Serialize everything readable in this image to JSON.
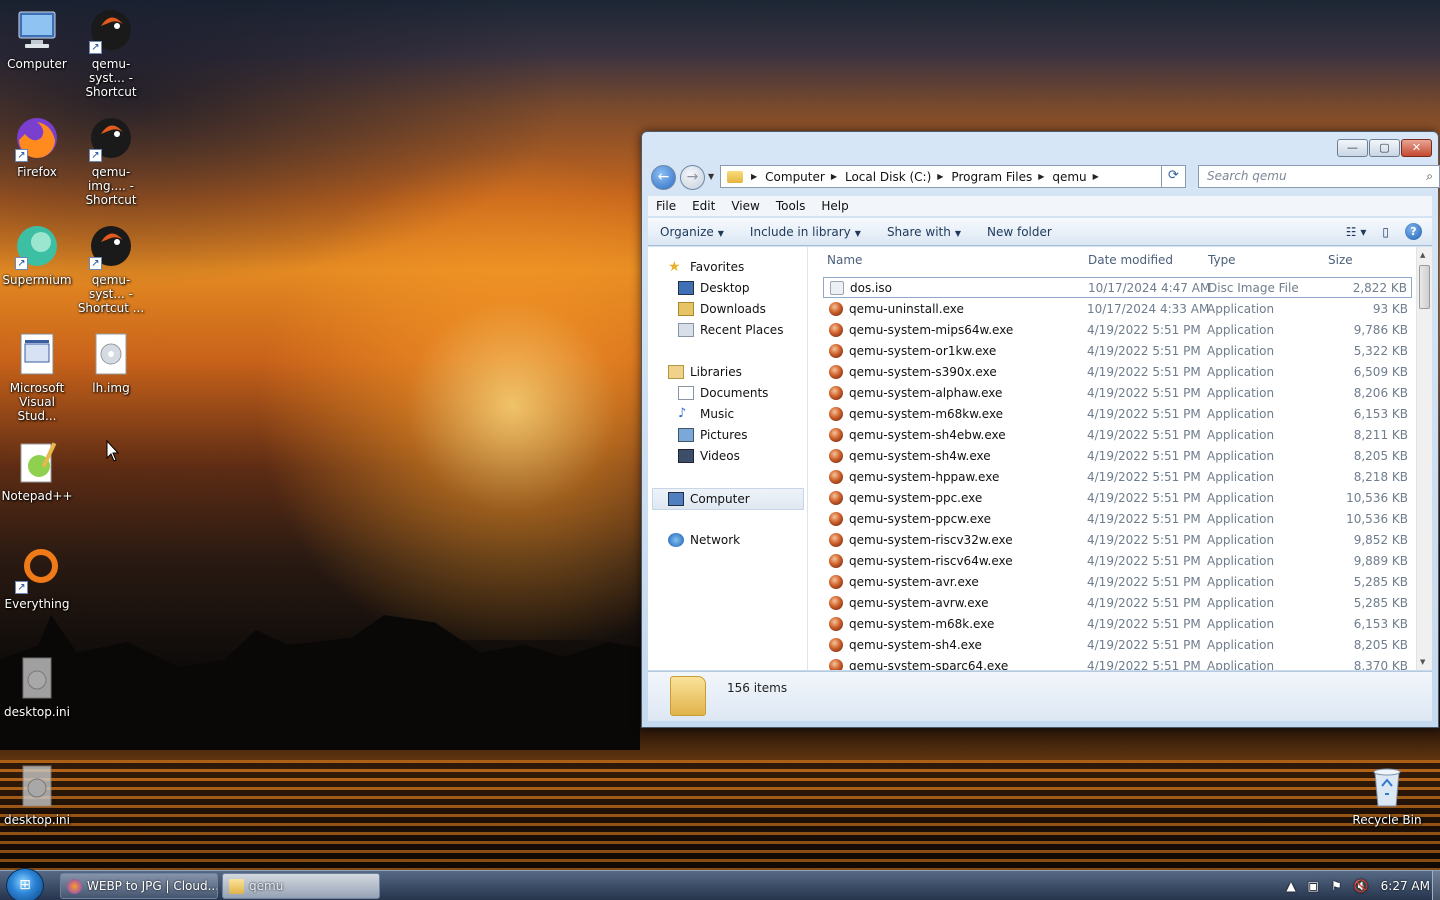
{
  "desktop": {
    "icons": [
      {
        "label": "Computer",
        "icon": "computer-icon"
      },
      {
        "label": "qemu-syst... - Shortcut",
        "icon": "qemu-icon"
      },
      {
        "label": "Firefox",
        "icon": "firefox-icon"
      },
      {
        "label": "qemu-img.... - Shortcut",
        "icon": "qemu-icon"
      },
      {
        "label": "Supermium",
        "icon": "supermium-icon"
      },
      {
        "label": "qemu-syst... - Shortcut ...",
        "icon": "qemu-icon"
      },
      {
        "label": "Microsoft Visual Stud...",
        "icon": "visual-studio-icon"
      },
      {
        "label": "lh.img",
        "icon": "disc-image-icon"
      },
      {
        "label": "Notepad++",
        "icon": "notepadpp-icon"
      },
      {
        "label": "Everything",
        "icon": "everything-icon"
      },
      {
        "label": "desktop.ini",
        "icon": "ini-file-icon"
      },
      {
        "label": "desktop.ini",
        "icon": "ini-file-icon"
      },
      {
        "label": "Recycle Bin",
        "icon": "recycle-bin-icon"
      }
    ]
  },
  "explorer": {
    "breadcrumb": [
      "Computer",
      "Local Disk (C:)",
      "Program Files",
      "qemu"
    ],
    "search_placeholder": "Search qemu",
    "menu": [
      "File",
      "Edit",
      "View",
      "Tools",
      "Help"
    ],
    "commands": [
      "Organize",
      "Include in library",
      "Share with",
      "New folder"
    ],
    "nav": {
      "favorites": {
        "label": "Favorites",
        "items": [
          "Desktop",
          "Downloads",
          "Recent Places"
        ]
      },
      "libraries": {
        "label": "Libraries",
        "items": [
          "Documents",
          "Music",
          "Pictures",
          "Videos"
        ]
      },
      "computer": "Computer",
      "network": "Network"
    },
    "columns": {
      "name": "Name",
      "date": "Date modified",
      "type": "Type",
      "size": "Size"
    },
    "files": [
      {
        "name": "dos.iso",
        "date": "10/17/2024 4:47 AM",
        "type": "Disc Image File",
        "size": "2,822 KB",
        "icon": "disc"
      },
      {
        "name": "qemu-uninstall.exe",
        "date": "10/17/2024 4:33 AM",
        "type": "Application",
        "size": "93 KB",
        "icon": "app"
      },
      {
        "name": "qemu-system-mips64w.exe",
        "date": "4/19/2022 5:51 PM",
        "type": "Application",
        "size": "9,786 KB",
        "icon": "app"
      },
      {
        "name": "qemu-system-or1kw.exe",
        "date": "4/19/2022 5:51 PM",
        "type": "Application",
        "size": "5,322 KB",
        "icon": "app"
      },
      {
        "name": "qemu-system-s390x.exe",
        "date": "4/19/2022 5:51 PM",
        "type": "Application",
        "size": "6,509 KB",
        "icon": "app"
      },
      {
        "name": "qemu-system-alphaw.exe",
        "date": "4/19/2022 5:51 PM",
        "type": "Application",
        "size": "8,206 KB",
        "icon": "app"
      },
      {
        "name": "qemu-system-m68kw.exe",
        "date": "4/19/2022 5:51 PM",
        "type": "Application",
        "size": "6,153 KB",
        "icon": "app"
      },
      {
        "name": "qemu-system-sh4ebw.exe",
        "date": "4/19/2022 5:51 PM",
        "type": "Application",
        "size": "8,211 KB",
        "icon": "app"
      },
      {
        "name": "qemu-system-sh4w.exe",
        "date": "4/19/2022 5:51 PM",
        "type": "Application",
        "size": "8,205 KB",
        "icon": "app"
      },
      {
        "name": "qemu-system-hppaw.exe",
        "date": "4/19/2022 5:51 PM",
        "type": "Application",
        "size": "8,218 KB",
        "icon": "app"
      },
      {
        "name": "qemu-system-ppc.exe",
        "date": "4/19/2022 5:51 PM",
        "type": "Application",
        "size": "10,536 KB",
        "icon": "app"
      },
      {
        "name": "qemu-system-ppcw.exe",
        "date": "4/19/2022 5:51 PM",
        "type": "Application",
        "size": "10,536 KB",
        "icon": "app"
      },
      {
        "name": "qemu-system-riscv32w.exe",
        "date": "4/19/2022 5:51 PM",
        "type": "Application",
        "size": "9,852 KB",
        "icon": "app"
      },
      {
        "name": "qemu-system-riscv64w.exe",
        "date": "4/19/2022 5:51 PM",
        "type": "Application",
        "size": "9,889 KB",
        "icon": "app"
      },
      {
        "name": "qemu-system-avr.exe",
        "date": "4/19/2022 5:51 PM",
        "type": "Application",
        "size": "5,285 KB",
        "icon": "app"
      },
      {
        "name": "qemu-system-avrw.exe",
        "date": "4/19/2022 5:51 PM",
        "type": "Application",
        "size": "5,285 KB",
        "icon": "app"
      },
      {
        "name": "qemu-system-m68k.exe",
        "date": "4/19/2022 5:51 PM",
        "type": "Application",
        "size": "6,153 KB",
        "icon": "app"
      },
      {
        "name": "qemu-system-sh4.exe",
        "date": "4/19/2022 5:51 PM",
        "type": "Application",
        "size": "8,205 KB",
        "icon": "app"
      },
      {
        "name": "qemu-system-sparc64.exe",
        "date": "4/19/2022 5:51 PM",
        "type": "Application",
        "size": "8,370 KB",
        "icon": "app"
      }
    ],
    "status": "156 items"
  },
  "taskbar": {
    "buttons": [
      {
        "label": "WEBP to JPG | Cloud...",
        "icon": "firefox-icon"
      },
      {
        "label": "qemu",
        "icon": "folder-icon"
      }
    ],
    "clock": "6:27 AM"
  }
}
